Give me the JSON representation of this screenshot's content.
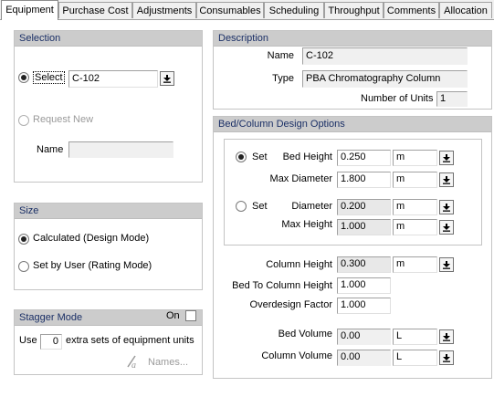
{
  "tabs": [
    "Equipment",
    "Purchase Cost",
    "Adjustments",
    "Consumables",
    "Scheduling",
    "Throughput",
    "Comments",
    "Allocation"
  ],
  "selection": {
    "title": "Selection",
    "select_label": "Select",
    "select_value": "C-102",
    "request_new_label": "Request New",
    "name_label": "Name",
    "name_value": ""
  },
  "size": {
    "title": "Size",
    "calculated_label": "Calculated (Design Mode)",
    "set_by_user_label": "Set by User (Rating Mode)"
  },
  "stagger": {
    "title": "Stagger Mode",
    "on_label": "On",
    "use_label": "Use",
    "use_value": "0",
    "extra_label": "extra sets of equipment units",
    "names_label": "Names..."
  },
  "description": {
    "title": "Description",
    "name_label": "Name",
    "name_value": "C-102",
    "type_label": "Type",
    "type_value": "PBA Chromatography Column",
    "units_label": "Number of Units",
    "units_value": "1"
  },
  "bed": {
    "title": "Bed/Column Design Options",
    "set_label": "Set",
    "bed_height_label": "Bed Height",
    "bed_height_value": "0.250",
    "bed_height_unit": "m",
    "max_diameter_label": "Max Diameter",
    "max_diameter_value": "1.800",
    "max_diameter_unit": "m",
    "set2_label": "Set",
    "diameter_label": "Diameter",
    "diameter_value": "0.200",
    "diameter_unit": "m",
    "max_height_label": "Max Height",
    "max_height_value": "1.000",
    "max_height_unit": "m",
    "column_height_label": "Column Height",
    "column_height_value": "0.300",
    "column_height_unit": "m",
    "bed_to_col_label": "Bed To Column Height",
    "bed_to_col_value": "1.000",
    "overdesign_label": "Overdesign Factor",
    "overdesign_value": "1.000",
    "bed_volume_label": "Bed Volume",
    "bed_volume_value": "0.00",
    "bed_volume_unit": "L",
    "column_volume_label": "Column Volume",
    "column_volume_value": "0.00",
    "column_volume_unit": "L"
  }
}
